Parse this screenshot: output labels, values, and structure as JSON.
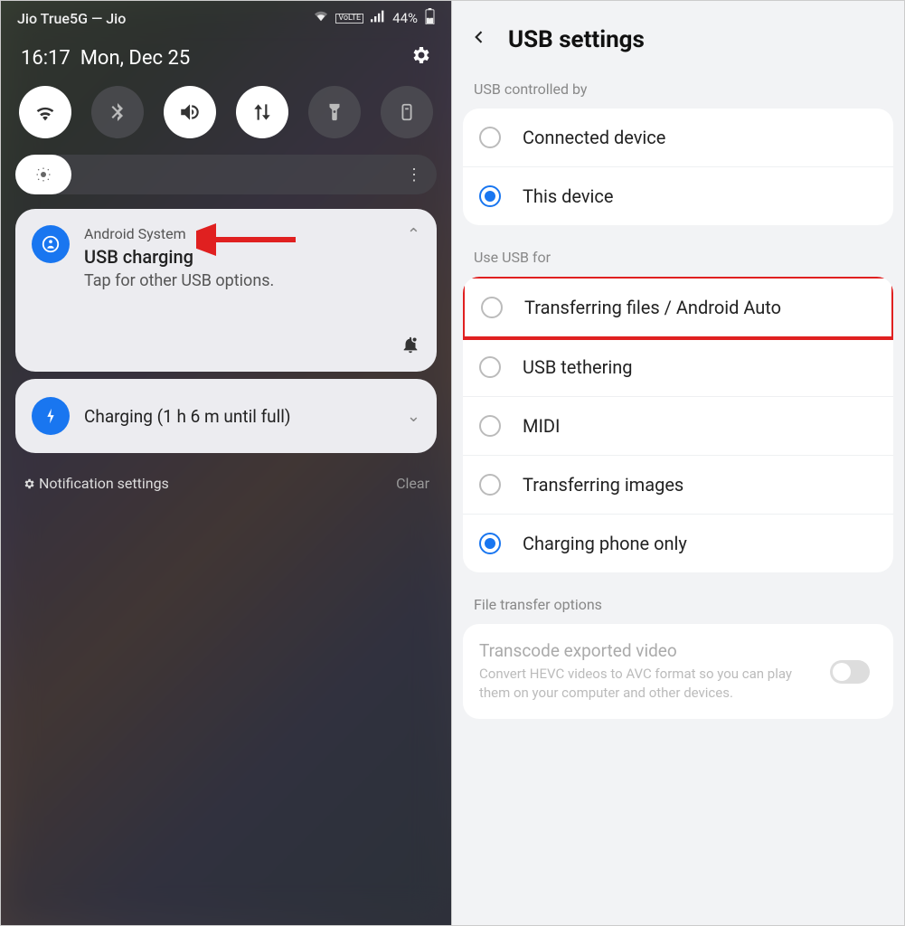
{
  "statusbar": {
    "carrier": "Jio True5G — Jio",
    "volte": "VoLTE",
    "battery": "44%"
  },
  "shade": {
    "time": "16:17",
    "date": "Mon, Dec 25"
  },
  "notification1": {
    "source": "Android System",
    "title": "USB charging",
    "subtitle": "Tap for other USB options."
  },
  "notification2": {
    "title": "Charging (1 h 6 m until full)"
  },
  "footer": {
    "settings": "Notification settings",
    "clear": "Clear"
  },
  "usb": {
    "title": "USB settings",
    "section1": "USB controlled by",
    "opt_connected": "Connected device",
    "opt_this": "This device",
    "section2": "Use USB for",
    "opt_transfer": "Transferring files / Android Auto",
    "opt_tether": "USB tethering",
    "opt_midi": "MIDI",
    "opt_images": "Transferring images",
    "opt_charge": "Charging phone only",
    "section3": "File transfer options",
    "ft_title": "Transcode exported video",
    "ft_desc": "Convert HEVC videos to AVC format so you can play them on your computer and other devices."
  }
}
